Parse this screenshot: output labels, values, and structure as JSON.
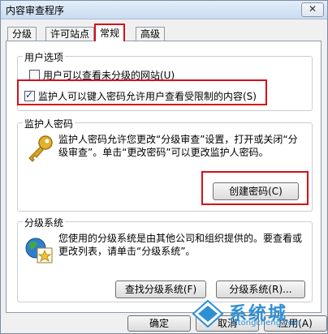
{
  "window": {
    "title": "内容审查程序",
    "close_label": "✕"
  },
  "tabs": [
    {
      "label": "分级"
    },
    {
      "label": "许可站点"
    },
    {
      "label": "常规",
      "active": true
    },
    {
      "label": "高级"
    }
  ],
  "user_options": {
    "title": "用户选项",
    "option_unrated": {
      "label": "用户可以查看未分级的网站(U)",
      "checked": false
    },
    "option_supervisor": {
      "label": "监护人可以键入密码允许用户查看受限制的内容(S)",
      "checked": true
    }
  },
  "supervisor_password": {
    "title": "监护人密码",
    "description": "监护人密码允许您更改“分级审查”设置，打开或关闭“分级审查”。单击“更改密码”可以更改监护人密码。",
    "create_button": "创建密码(C)",
    "icon": "key-icon"
  },
  "rating_systems": {
    "title": "分级系统",
    "description": "您使用的分级系统是由其他公司和组织提供的。要查看或更改列表，请单击“分级系统”。",
    "find_button": "查找分级系统(F)",
    "systems_button": "分级系统(R)...",
    "icon": "globe-certificate-icon"
  },
  "footer": {
    "ok_button": "确定",
    "cancel_button": "取消",
    "apply_button": "应用(A)"
  },
  "watermark": {
    "text": "系统城",
    "sub": "xitongcheng.com"
  },
  "colors": {
    "highlight": "#d4101a",
    "watermark": "#2f8fd3"
  }
}
